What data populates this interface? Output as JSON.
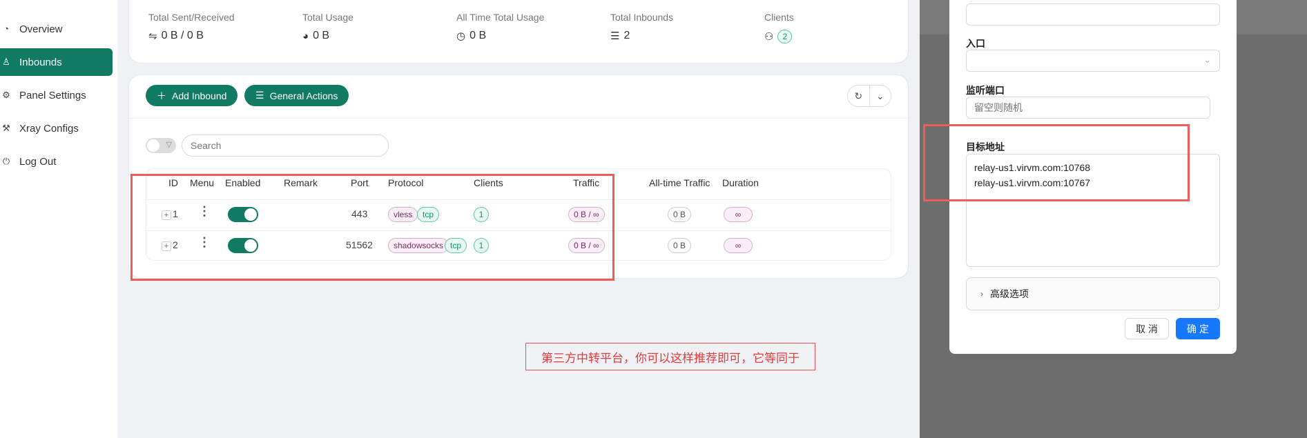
{
  "sidebar": {
    "items": [
      {
        "label": "Overview",
        "icon": "dashboard-icon",
        "active": false
      },
      {
        "label": "Inbounds",
        "icon": "user-icon",
        "active": true
      },
      {
        "label": "Panel Settings",
        "icon": "gear-icon",
        "active": false
      },
      {
        "label": "Xray Configs",
        "icon": "tool-icon",
        "active": false
      },
      {
        "label": "Log Out",
        "icon": "logout-icon",
        "active": false
      }
    ]
  },
  "stats": {
    "sent_received": {
      "label": "Total Sent/Received",
      "value": "0 B / 0 B"
    },
    "total_usage": {
      "label": "Total Usage",
      "value": "0 B"
    },
    "all_time": {
      "label": "All Time Total Usage",
      "value": "0 B"
    },
    "inbounds": {
      "label": "Total Inbounds",
      "value": "2"
    },
    "clients": {
      "label": "Clients",
      "value": "2"
    }
  },
  "toolbar": {
    "add_inbound": "Add Inbound",
    "general_actions": "General Actions",
    "search_placeholder": "Search"
  },
  "table": {
    "headers": {
      "id": "ID",
      "menu": "Menu",
      "enabled": "Enabled",
      "remark": "Remark",
      "port": "Port",
      "protocol": "Protocol",
      "clients": "Clients",
      "traffic": "Traffic",
      "all_time_traffic": "All-time Traffic",
      "duration": "Duration"
    },
    "rows": [
      {
        "id": "1",
        "port": "443",
        "protocol": "vless",
        "transport": "tcp",
        "clients": "1",
        "traffic": "0 B / ∞",
        "all_time": "0 B",
        "duration": "∞",
        "enabled": true
      },
      {
        "id": "2",
        "port": "51562",
        "protocol": "shadowsocks",
        "transport": "tcp",
        "clients": "1",
        "traffic": "0 B / ∞",
        "all_time": "0 B",
        "duration": "∞",
        "enabled": true
      }
    ]
  },
  "modal": {
    "entry_label": "入口",
    "listen_port_label": "监听端口",
    "listen_port_placeholder": "留空则随机",
    "target_label": "目标地址",
    "target_lines": [
      "relay-us1.virvm.com:10768",
      "relay-us1.virvm.com:10767"
    ],
    "advanced_label": "高级选项",
    "cancel_label": "取 消",
    "ok_label": "确 定"
  },
  "annotation": {
    "text": "第三方中转平台，你可以这样推荐即可，它等同于"
  },
  "colors": {
    "brand_green": "#107b62",
    "primary_blue": "#1677ff",
    "annotation_red": "#ef5a5a"
  }
}
